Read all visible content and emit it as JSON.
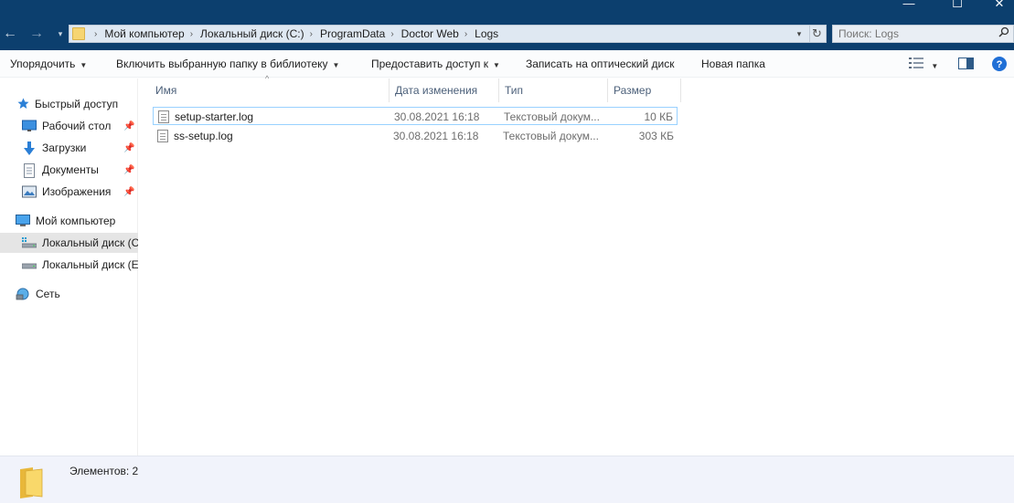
{
  "window": {
    "minimize_glyph": "—",
    "maximize_glyph": "☐",
    "close_glyph": "✕"
  },
  "nav": {
    "back_glyph": "←",
    "forward_glyph": "→",
    "recent_glyph": "▾",
    "refresh_glyph": "↻"
  },
  "address": {
    "crumbs": [
      "Мой компьютер",
      "Локальный диск (C:)",
      "ProgramData",
      "Doctor Web",
      "Logs"
    ]
  },
  "search": {
    "placeholder": "Поиск: Logs"
  },
  "toolbar": {
    "organize": "Упорядочить",
    "include_library": "Включить выбранную папку в библиотеку",
    "share": "Предоставить доступ к",
    "burn": "Записать на оптический диск",
    "new_folder": "Новая папка"
  },
  "sidebar": {
    "items": [
      {
        "label": "Быстрый доступ",
        "icon": "star-icon"
      },
      {
        "label": "Рабочий стол",
        "icon": "desktop-icon",
        "pinned": true
      },
      {
        "label": "Загрузки",
        "icon": "download-icon",
        "pinned": true
      },
      {
        "label": "Документы",
        "icon": "documents-icon",
        "pinned": true
      },
      {
        "label": "Изображения",
        "icon": "pictures-icon",
        "pinned": true
      },
      {
        "label": "Мой компьютер",
        "icon": "computer-icon"
      },
      {
        "label": "Локальный диск (C",
        "icon": "drive-icon",
        "selected": true
      },
      {
        "label": "Локальный диск (E",
        "icon": "drive-icon"
      },
      {
        "label": "Сеть",
        "icon": "network-icon"
      }
    ]
  },
  "columns": {
    "name": "Имя",
    "date": "Дата изменения",
    "type": "Тип",
    "size": "Размер"
  },
  "files": [
    {
      "name": "setup-starter.log",
      "date": "30.08.2021 16:18",
      "type": "Текстовый докум...",
      "size": "10 КБ"
    },
    {
      "name": "ss-setup.log",
      "date": "30.08.2021 16:18",
      "type": "Текстовый докум...",
      "size": "303 КБ"
    }
  ],
  "status": {
    "count": "Элементов: 2"
  },
  "colors": {
    "titlebar": "#0c3f6e",
    "address_bg": "#dfe8f2",
    "selection_border": "#99d1ff",
    "status_bg": "#f1f3fb"
  }
}
